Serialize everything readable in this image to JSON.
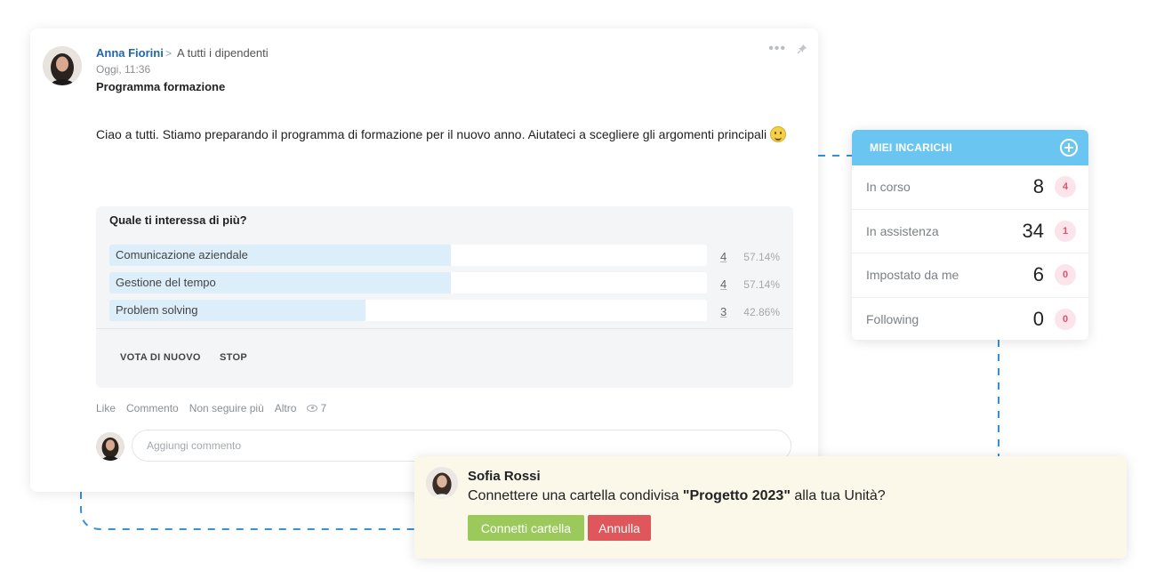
{
  "post": {
    "author": "Anna Fiorini",
    "recipients": "A tutti i dipendenti",
    "timestamp": "Oggi, 11:36",
    "title": "Programma formazione",
    "body": "Ciao a tutti. Stiamo preparando il programma di formazione per il nuovo anno. Aiutateci a scegliere gli argomenti principali",
    "more_icon": "more-dots-icon",
    "pin_icon": "pin-icon"
  },
  "poll": {
    "question": "Quale ti interessa di più?",
    "options": [
      {
        "label": "Comunicazione aziendale",
        "count": "4",
        "percent": "57.14%",
        "fraction": 0.5714
      },
      {
        "label": "Gestione del tempo",
        "count": "4",
        "percent": "57.14%",
        "fraction": 0.5714
      },
      {
        "label": "Problem solving",
        "count": "3",
        "percent": "42.86%",
        "fraction": 0.4286
      }
    ],
    "vote_again": "VOTA DI NUOVO",
    "stop": "STOP"
  },
  "footer": {
    "like": "Like",
    "comment": "Commento",
    "unfollow": "Non seguire più",
    "more": "Altro",
    "views": "7"
  },
  "comment_box": {
    "placeholder": "Aggiungi commento"
  },
  "tasks": {
    "title": "MIEI INCARICHI",
    "rows": [
      {
        "label": "In corso",
        "count": "8",
        "badge": "4"
      },
      {
        "label": "In assistenza",
        "count": "34",
        "badge": "1"
      },
      {
        "label": "Impostato da me",
        "count": "6",
        "badge": "0"
      },
      {
        "label": "Following",
        "count": "0",
        "badge": "0"
      }
    ]
  },
  "notification": {
    "name": "Sofia Rossi",
    "message_pre": "Connettere una cartella condivisa ",
    "message_bold": "\"Progetto 2023\"",
    "message_post": " alla tua Unità?",
    "confirm": "Connetti cartella",
    "cancel": "Annulla"
  },
  "colors": {
    "accent_blue": "#6ac6f1",
    "author_link": "#2067b0",
    "confirm_green": "#9bc95c",
    "cancel_red": "#e0575b",
    "poll_fill": "#dbeef9",
    "connector": "#3a8fd6"
  }
}
